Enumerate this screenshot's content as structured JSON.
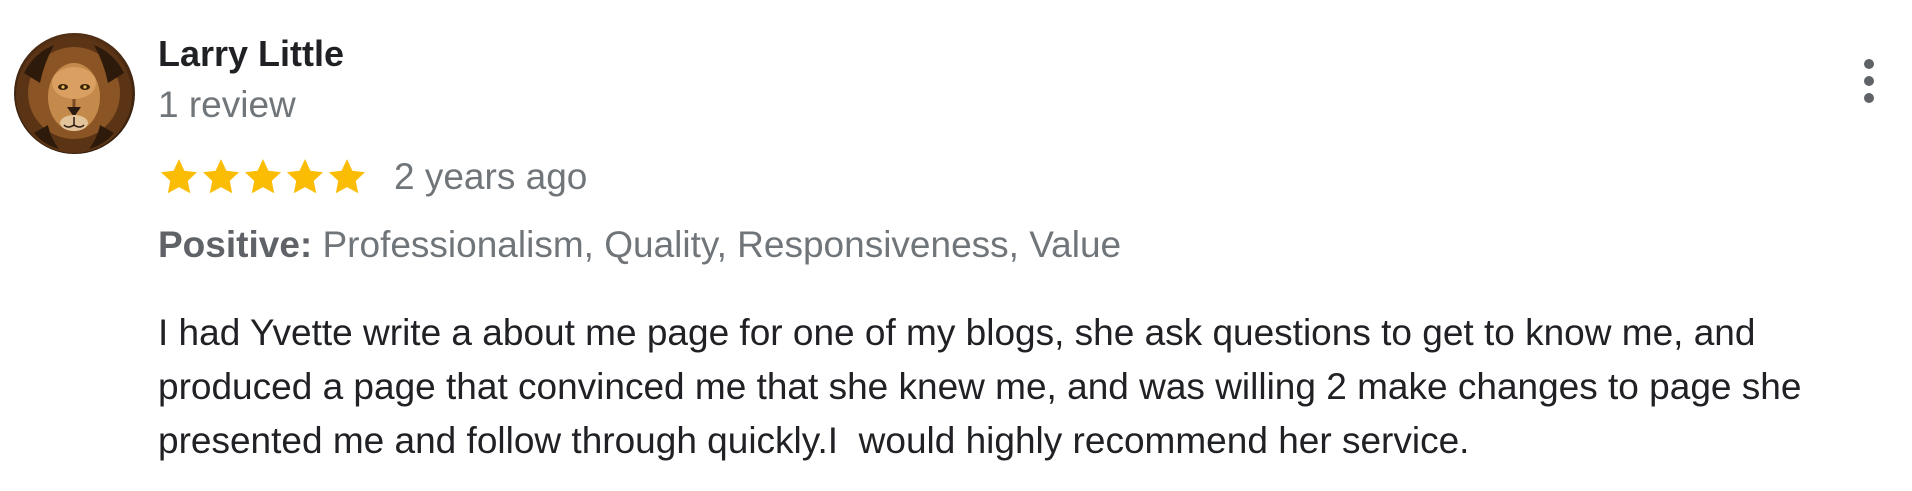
{
  "review": {
    "author": {
      "name": "Larry Little",
      "review_count": "1 review",
      "avatar_icon": "lion-avatar"
    },
    "rating": 5,
    "rating_max": 5,
    "star_color": "#fbbc04",
    "time_ago": "2 years ago",
    "attributes": {
      "label": "Positive:",
      "values": " Professionalism, Quality, Responsiveness, Value"
    },
    "text": "I had Yvette write a about me page for one of my blogs, she ask questions to get to know me, and produced a page that convinced me that she knew me, and was willing 2 make changes to page she presented me and follow through quickly.I  would highly recommend her service.",
    "menu_icon": "more-vert-icon"
  }
}
